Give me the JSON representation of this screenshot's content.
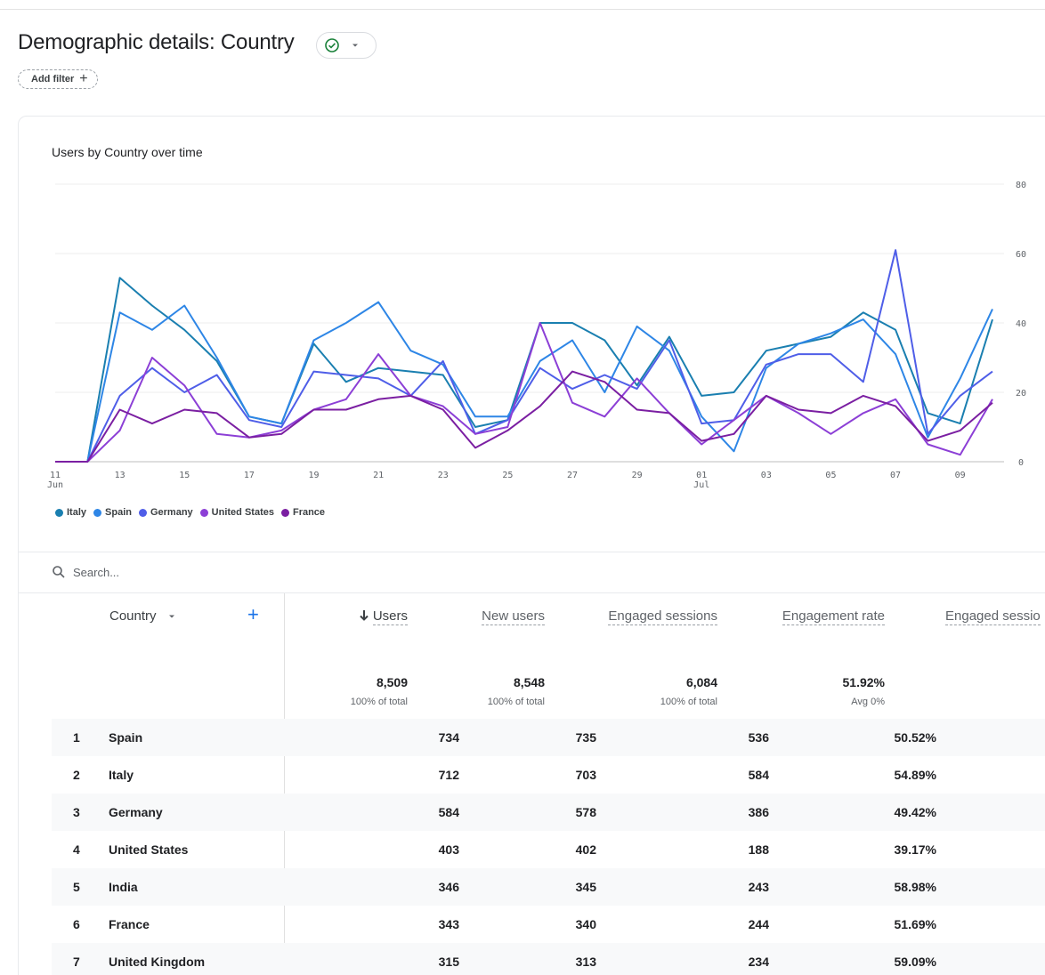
{
  "page": {
    "title": "Demographic details: Country",
    "add_filter_label": "Add filter",
    "add_filter_plus": "+"
  },
  "chart_data": {
    "type": "line",
    "title": "Users by Country over time",
    "x": [
      "11",
      "12",
      "13",
      "14",
      "15",
      "16",
      "17",
      "18",
      "19",
      "20",
      "21",
      "22",
      "23",
      "24",
      "25",
      "26",
      "27",
      "28",
      "29",
      "30",
      "01",
      "02",
      "03",
      "04",
      "05",
      "06",
      "07",
      "08",
      "09",
      "10"
    ],
    "x_tick_labels": [
      "11",
      "13",
      "15",
      "17",
      "19",
      "21",
      "23",
      "25",
      "27",
      "29",
      "01",
      "03",
      "05",
      "07",
      "09"
    ],
    "x_tick_sublabels": {
      "11": "Jun",
      "01": "Jul"
    },
    "ylim": [
      0,
      80
    ],
    "y_ticks": [
      "0",
      "20",
      "40",
      "60",
      "80"
    ],
    "grid": true,
    "legend_position": "bottom-left",
    "series": [
      {
        "name": "Italy",
        "color": "#1a7fb0",
        "values": [
          0,
          0,
          53,
          45,
          38,
          29,
          13,
          11,
          34,
          23,
          27,
          26,
          25,
          10,
          12,
          40,
          40,
          35,
          22,
          36,
          19,
          20,
          32,
          34,
          36,
          43,
          38,
          14,
          11,
          41
        ]
      },
      {
        "name": "Spain",
        "color": "#2e86e6",
        "values": [
          0,
          0,
          43,
          38,
          45,
          30,
          13,
          11,
          35,
          40,
          46,
          32,
          28,
          13,
          13,
          29,
          35,
          20,
          39,
          32,
          13,
          3,
          27,
          34,
          37,
          41,
          31,
          7,
          24,
          44
        ]
      },
      {
        "name": "Germany",
        "color": "#4f5ee8",
        "values": [
          0,
          0,
          19,
          27,
          20,
          25,
          12,
          10,
          26,
          25,
          24,
          19,
          29,
          8,
          12,
          27,
          21,
          25,
          21,
          35,
          11,
          12,
          28,
          31,
          31,
          23,
          61,
          8,
          19,
          26
        ]
      },
      {
        "name": "United States",
        "color": "#8c3fd6",
        "values": [
          0,
          0,
          9,
          30,
          22,
          8,
          7,
          9,
          15,
          18,
          31,
          19,
          16,
          8,
          10,
          40,
          17,
          13,
          24,
          14,
          5,
          12,
          19,
          14,
          8,
          14,
          18,
          5,
          2,
          18
        ]
      },
      {
        "name": "France",
        "color": "#7b1fa2",
        "values": [
          0,
          0,
          15,
          11,
          15,
          14,
          7,
          8,
          15,
          15,
          18,
          19,
          15,
          4,
          9,
          16,
          26,
          23,
          15,
          14,
          6,
          8,
          19,
          15,
          14,
          19,
          16,
          6,
          9,
          17
        ]
      }
    ]
  },
  "search": {
    "placeholder": "Search..."
  },
  "table": {
    "country_header": "Country",
    "add_dimension": "+",
    "columns": [
      "Users",
      "New users",
      "Engaged sessions",
      "Engagement rate",
      "Engaged sessio"
    ],
    "totals": [
      {
        "value": "8,509",
        "sub": "100% of total"
      },
      {
        "value": "8,548",
        "sub": "100% of total"
      },
      {
        "value": "6,084",
        "sub": "100% of total"
      },
      {
        "value": "51.92%",
        "sub": "Avg 0%"
      }
    ],
    "rows": [
      {
        "rank": "1",
        "country": "Spain",
        "users": "734",
        "new_users": "735",
        "engaged_sessions": "536",
        "engagement_rate": "50.52%"
      },
      {
        "rank": "2",
        "country": "Italy",
        "users": "712",
        "new_users": "703",
        "engaged_sessions": "584",
        "engagement_rate": "54.89%"
      },
      {
        "rank": "3",
        "country": "Germany",
        "users": "584",
        "new_users": "578",
        "engaged_sessions": "386",
        "engagement_rate": "49.42%"
      },
      {
        "rank": "4",
        "country": "United States",
        "users": "403",
        "new_users": "402",
        "engaged_sessions": "188",
        "engagement_rate": "39.17%"
      },
      {
        "rank": "5",
        "country": "India",
        "users": "346",
        "new_users": "345",
        "engaged_sessions": "243",
        "engagement_rate": "58.98%"
      },
      {
        "rank": "6",
        "country": "France",
        "users": "343",
        "new_users": "340",
        "engaged_sessions": "244",
        "engagement_rate": "51.69%"
      },
      {
        "rank": "7",
        "country": "United Kingdom",
        "users": "315",
        "new_users": "313",
        "engaged_sessions": "234",
        "engagement_rate": "59.09%"
      }
    ]
  }
}
